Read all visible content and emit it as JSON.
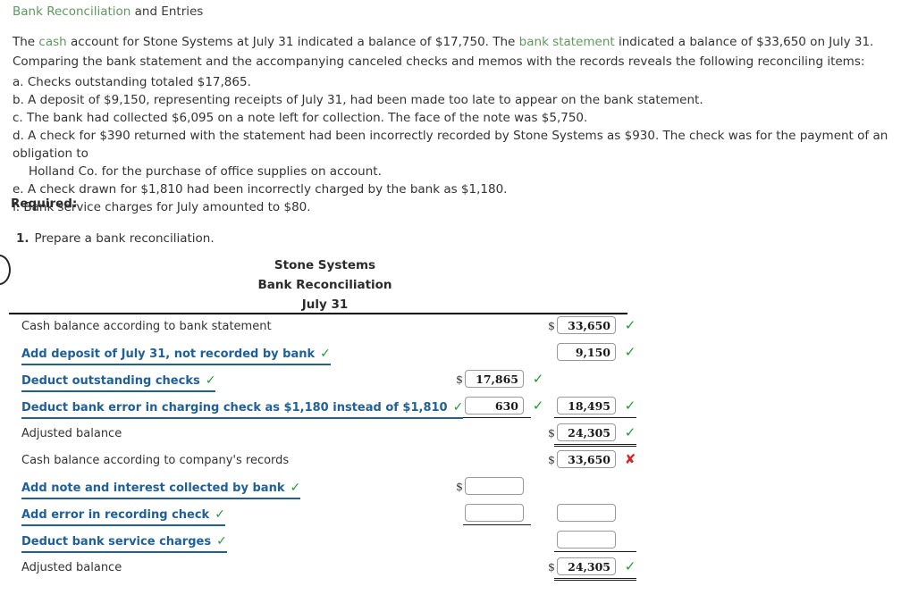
{
  "header": {
    "title_prefix": "Bank Reconciliation",
    "title_suffix": " and Entries"
  },
  "problem": {
    "para_part1": "The ",
    "para_term1": "cash",
    "para_part2": " account for Stone Systems at July 31 indicated a balance of $17,750. The ",
    "para_term2": "bank statement",
    "para_part3": " indicated a balance of $33,650 on July 31. Comparing the bank statement and the accompanying canceled checks and memos with the records reveals the following reconciling items:",
    "items": [
      "a. Checks outstanding totaled $17,865.",
      "b. A deposit of $9,150, representing receipts of July 31, had been made too late to appear on the bank statement.",
      "c. The bank had collected $6,095 on a note left for collection. The face of the note was $5,750.",
      "d. A check for $390 returned with the statement had been incorrectly recorded by Stone Systems as $930. The check was for the payment of an obligation to",
      "Holland Co. for the purchase of office supplies on account.",
      "e. A check drawn for $1,810 had been incorrectly charged by the bank as $1,180.",
      "f. Bank service charges for July amounted to $80."
    ],
    "required_label": "Required:",
    "task_number": "1.",
    "task_text": "Prepare a bank reconciliation."
  },
  "statement": {
    "company": "Stone Systems",
    "title": "Bank Reconciliation",
    "date": "July 31"
  },
  "colors": {
    "link": "#1f6099",
    "term_green": "#5c9a5c",
    "check_green": "#1a9e32",
    "cross_red": "#e02020"
  },
  "icons": {
    "check": "✓",
    "cross": "✘"
  },
  "rows": [
    {
      "id": "cash-balance-bank",
      "label": "Cash balance according to bank statement",
      "is_link": false,
      "label_check": false,
      "mid": null,
      "right": {
        "dollar": true,
        "value": "33,650",
        "mark": "ok"
      }
    },
    {
      "id": "add-deposit-july31",
      "label": "Add deposit of July 31, not recorded by bank",
      "is_link": true,
      "label_check": true,
      "mid": null,
      "right": {
        "dollar": false,
        "value": "9,150",
        "mark": "ok"
      }
    },
    {
      "id": "deduct-outstanding-checks",
      "label": "Deduct outstanding checks",
      "is_link": true,
      "label_check": true,
      "mid": {
        "dollar": true,
        "value": "17,865",
        "mark": "ok"
      },
      "right": null
    },
    {
      "id": "deduct-bank-error",
      "label": "Deduct bank error in charging check as $1,180 instead of $1,810",
      "is_link": true,
      "label_check": true,
      "mid": {
        "dollar": false,
        "value": "630",
        "mark": "ok"
      },
      "right": {
        "dollar": false,
        "value": "18,495",
        "mark": "ok"
      }
    },
    {
      "id": "adjusted-balance-bank",
      "label": "Adjusted balance",
      "is_link": false,
      "label_check": false,
      "mid": null,
      "right": {
        "dollar": true,
        "value": "24,305",
        "mark": "ok"
      }
    },
    {
      "id": "cash-balance-company",
      "label": "Cash balance according to company's records",
      "is_link": false,
      "label_check": false,
      "mid": null,
      "right": {
        "dollar": true,
        "value": "33,650",
        "mark": "bad"
      }
    },
    {
      "id": "add-note-interest",
      "label": "Add note and interest collected by bank",
      "is_link": true,
      "label_check": true,
      "mid": {
        "dollar": true,
        "value": "",
        "mark": "none"
      },
      "right": null
    },
    {
      "id": "add-error-recording-check",
      "label": "Add error in recording check",
      "is_link": true,
      "label_check": true,
      "mid": {
        "dollar": false,
        "value": "",
        "mark": "none"
      },
      "right": {
        "dollar": false,
        "value": "",
        "mark": "none"
      }
    },
    {
      "id": "deduct-bank-service-charges",
      "label": "Deduct bank service charges",
      "is_link": true,
      "label_check": true,
      "mid": null,
      "right": {
        "dollar": false,
        "value": "",
        "mark": "none"
      }
    },
    {
      "id": "adjusted-balance-company",
      "label": "Adjusted balance",
      "is_link": false,
      "label_check": false,
      "mid": null,
      "right": {
        "dollar": true,
        "value": "24,305",
        "mark": "ok"
      }
    }
  ]
}
